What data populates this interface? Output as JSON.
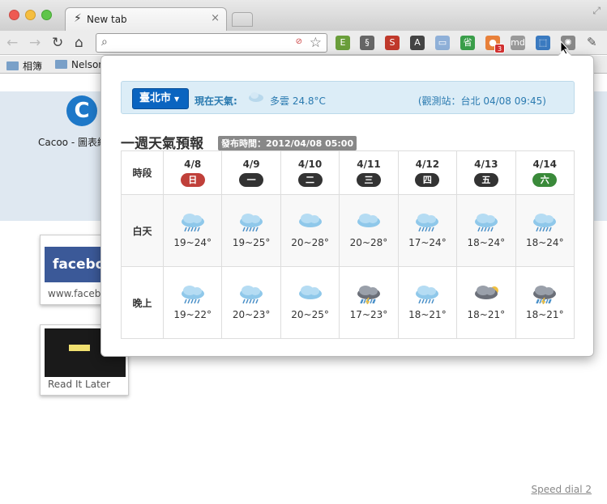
{
  "window": {
    "tab_title": "New tab",
    "tab_close": "×"
  },
  "toolbar": {
    "back": "←",
    "forward": "→",
    "reload": "↻",
    "home": "⌂",
    "search_icon": "search-icon",
    "star": "☆",
    "muted": "⊘",
    "wrench": "🔧",
    "extensions": [
      {
        "name": "evernote-icon",
        "glyph": "E",
        "color": "#6a9e3a"
      },
      {
        "name": "clip-icon",
        "glyph": "§",
        "color": "#666"
      },
      {
        "name": "s-icon",
        "glyph": "S",
        "color": "#c0392b"
      },
      {
        "name": "font-icon",
        "glyph": "A",
        "color": "#444"
      },
      {
        "name": "folder-icon",
        "glyph": "▭",
        "color": "#8fb0d8"
      },
      {
        "name": "save-icon",
        "glyph": "省",
        "color": "#3a9e4a"
      },
      {
        "name": "fox-icon",
        "glyph": "●",
        "color": "#e8803a"
      },
      {
        "name": "md-icon",
        "glyph": "md",
        "color": "#999"
      },
      {
        "name": "screenshot-icon",
        "glyph": "⬚",
        "color": "#3a7ac0"
      },
      {
        "name": "weather-ext-icon",
        "glyph": "✺",
        "color": "#888"
      }
    ],
    "badge": "3"
  },
  "bookmarks": [
    {
      "label": "相簿"
    },
    {
      "label": "Nelson"
    }
  ],
  "page": {
    "cacoo_label": "Cacoo - 圖表編",
    "tiles": [
      {
        "label": "www.faceb",
        "thumb_text": "facebo"
      },
      {
        "label": "Read It Later"
      }
    ],
    "speed_dial": "Speed dial 2"
  },
  "weather": {
    "city": "臺北市",
    "current_label": "現在天氣:",
    "current_desc": "多雲 24.8°C",
    "station": "(觀測站：台北 04/08 09:45)",
    "weekly_title": "一週天氣預報",
    "pub_time": "發布時間：2012/04/08 05:00",
    "row_labels": {
      "period": "時段",
      "day": "白天",
      "night": "晚上"
    },
    "days": [
      {
        "date": "4/8",
        "weekday": "日",
        "kind": "sun",
        "day_temp": "19~24°",
        "day_icon": "rain",
        "night_temp": "19~22°",
        "night_icon": "rain"
      },
      {
        "date": "4/9",
        "weekday": "一",
        "kind": "",
        "day_temp": "19~25°",
        "day_icon": "rain",
        "night_temp": "20~23°",
        "night_icon": "rain"
      },
      {
        "date": "4/10",
        "weekday": "二",
        "kind": "",
        "day_temp": "20~28°",
        "day_icon": "cloud",
        "night_temp": "20~25°",
        "night_icon": "cloud"
      },
      {
        "date": "4/11",
        "weekday": "三",
        "kind": "",
        "day_temp": "20~28°",
        "day_icon": "cloud",
        "night_temp": "17~23°",
        "night_icon": "storm"
      },
      {
        "date": "4/12",
        "weekday": "四",
        "kind": "",
        "day_temp": "17~24°",
        "day_icon": "rain",
        "night_temp": "18~21°",
        "night_icon": "rain"
      },
      {
        "date": "4/13",
        "weekday": "五",
        "kind": "",
        "day_temp": "18~24°",
        "day_icon": "rain",
        "night_temp": "18~21°",
        "night_icon": "darkcloud"
      },
      {
        "date": "4/14",
        "weekday": "六",
        "kind": "sat",
        "day_temp": "18~24°",
        "day_icon": "rain",
        "night_temp": "18~21°",
        "night_icon": "storm"
      }
    ]
  }
}
